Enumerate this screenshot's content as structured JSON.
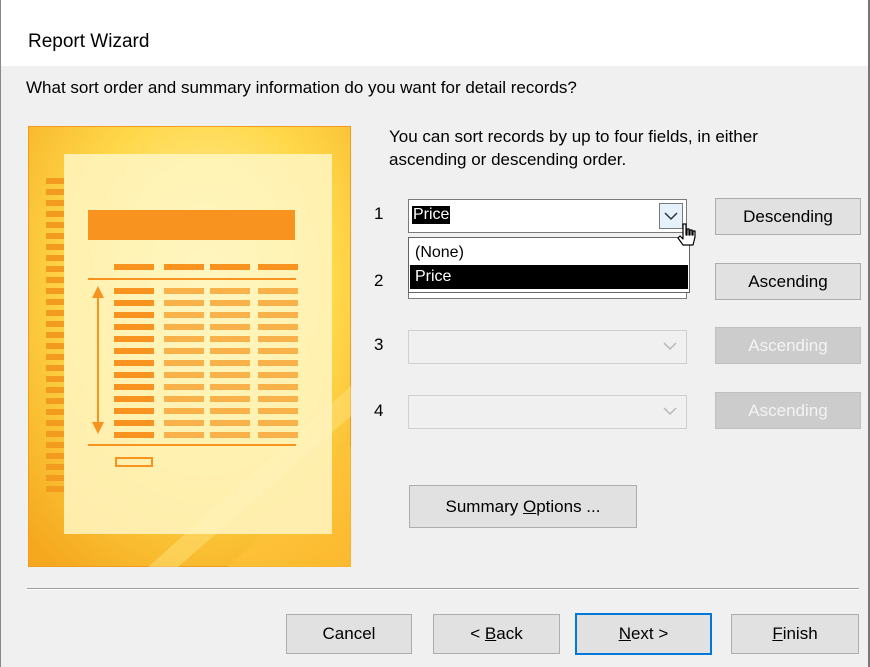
{
  "window": {
    "title": "Report Wizard"
  },
  "question": "What sort order and summary information do you want for detail records?",
  "instructions": {
    "line1": "You can sort records by up to four fields, in either",
    "line2": "ascending or descending order."
  },
  "sort_fields": [
    {
      "number": "1",
      "value": "Price",
      "order": "Descending",
      "enabled": true
    },
    {
      "number": "2",
      "value": "",
      "order": "Ascending",
      "enabled": true
    },
    {
      "number": "3",
      "value": "",
      "order": "Ascending",
      "enabled": false
    },
    {
      "number": "4",
      "value": "",
      "order": "Ascending",
      "enabled": false
    }
  ],
  "dropdown": {
    "options": [
      "(None)",
      "Price"
    ],
    "highlighted": "Price"
  },
  "buttons": {
    "summary_options": {
      "pre": "Summary ",
      "mnemonic": "O",
      "post": "ptions ..."
    },
    "cancel": "Cancel",
    "back": {
      "pre": "< ",
      "mnemonic": "B",
      "post": "ack"
    },
    "next": {
      "pre": "",
      "mnemonic": "N",
      "post": "ext >"
    },
    "finish": {
      "pre": "",
      "mnemonic": "F",
      "post": "inish"
    }
  },
  "colors": {
    "accent": "#0078d7",
    "illustration_yellow": "#ffc83d",
    "illustration_orange": "#f7931e"
  }
}
